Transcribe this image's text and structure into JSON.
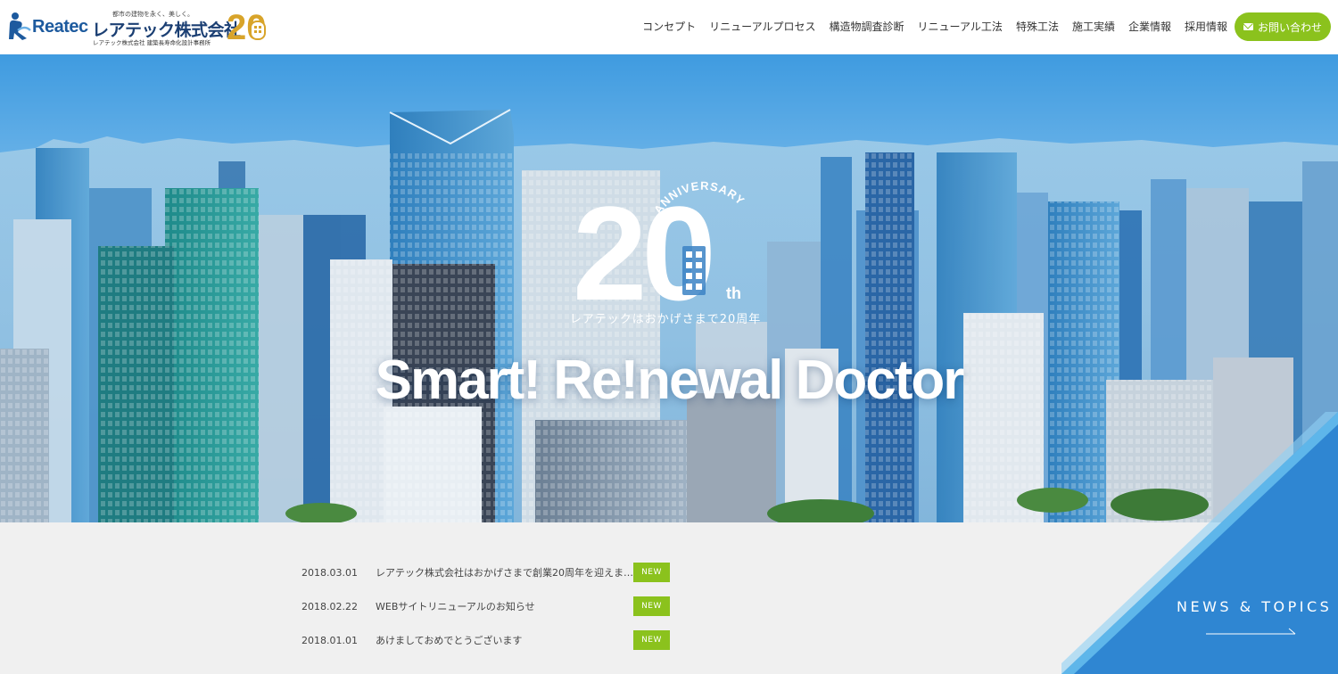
{
  "header": {
    "logo": {
      "brand": "Reatec",
      "tagline": "都市の建物を永く、美しく。",
      "company_name": "レアテック株式会社",
      "sub": "レアテック株式会社 建築長寿命化設計事務所",
      "anniversary_mark": "20"
    },
    "nav": [
      {
        "label": "コンセプト"
      },
      {
        "label": "リニューアルプロセス"
      },
      {
        "label": "構造物調査診断"
      },
      {
        "label": "リニューアル工法"
      },
      {
        "label": "特殊工法"
      },
      {
        "label": "施工実績"
      },
      {
        "label": "企業情報"
      },
      {
        "label": "採用情報"
      }
    ],
    "contact_label": "お問い合わせ",
    "contact_icon": "mail-icon"
  },
  "hero": {
    "anniversary_number": "20",
    "anniversary_word": "ANNIVERSARY",
    "anniversary_suffix": "th",
    "anniversary_caption": "レアテックはおかげさまで20周年",
    "tagline": "Smart! Re!newal Doctor"
  },
  "news": {
    "items": [
      {
        "date": "2018.03.01",
        "title": "レアテック株式会社はおかげさまで創業20周年を迎えま…",
        "badge": "NEW"
      },
      {
        "date": "2018.02.22",
        "title": "WEBサイトリニューアルのお知らせ",
        "badge": "NEW"
      },
      {
        "date": "2018.01.01",
        "title": "あけましておめでとうございます",
        "badge": "NEW"
      }
    ],
    "section_label": "NEWS & TOPICS"
  },
  "colors": {
    "accent_green": "#8bc21d",
    "brand_blue": "#1d5a9e",
    "panel_blue": "#2f86d2"
  }
}
